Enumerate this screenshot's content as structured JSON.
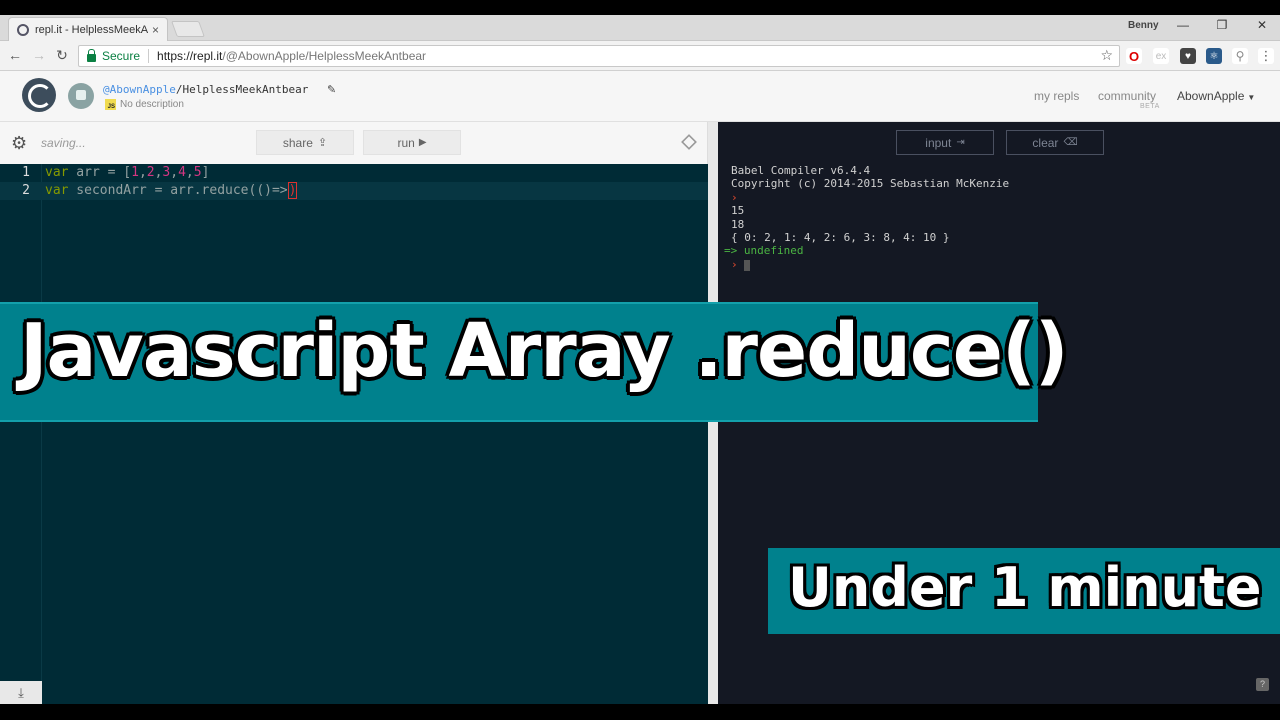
{
  "browser": {
    "tab_title": "repl.it - HelplessMeekAn",
    "tab_close": "×",
    "profile": "Benny",
    "window_controls": [
      "—",
      "❐",
      "✕"
    ],
    "secure_label": "Secure",
    "url_host": "https://repl.it",
    "url_path": "/@AbownApple/HelplessMeekAntbear",
    "ext_labels": [
      "ex"
    ]
  },
  "header": {
    "user": "@AbownApple",
    "slash": "/",
    "repl_name": "HelplessMeekAntbear",
    "description": "No description",
    "js_badge": "JS",
    "links": {
      "my_repls": "my repls",
      "community": "community",
      "beta": "BETA"
    },
    "account": "AbownApple"
  },
  "editor": {
    "status": "saving...",
    "share_label": "share",
    "run_label": "run",
    "lines": [
      {
        "num": "1"
      },
      {
        "num": "2"
      }
    ]
  },
  "console": {
    "input_label": "input",
    "clear_label": "clear",
    "lines": [
      "Babel Compiler v6.4.4",
      "Copyright (c) 2014-2015 Sebastian McKenzie",
      "15",
      "18",
      "{ 0: 2, 1: 4, 2: 6, 3: 8, 4: 10 }",
      "undefined"
    ],
    "prompt": "›",
    "result_arrow": "=>"
  },
  "overlay": {
    "title": "Javascript Array .reduce()",
    "subtitle": "Under 1 minute"
  },
  "colors": {
    "banner": "#00818d",
    "editor_bg": "#002b36",
    "console_bg": "#141823"
  }
}
